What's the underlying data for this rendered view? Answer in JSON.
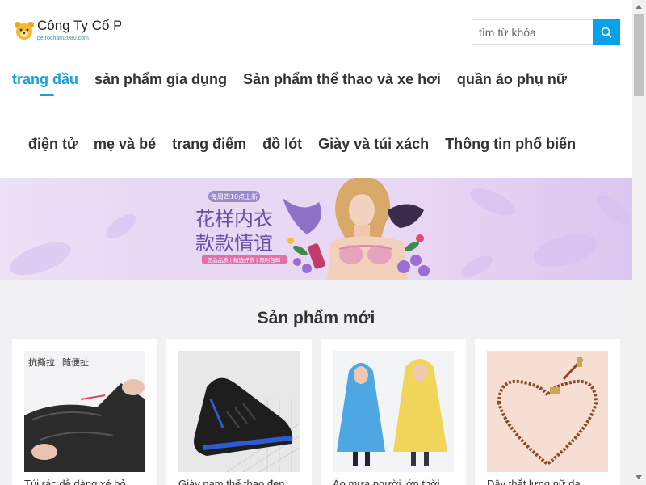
{
  "header": {
    "company_name": "Công Ty Cổ P",
    "company_sub": "petrocham2080.com",
    "search_placeholder": "tìm từ khóa"
  },
  "nav": {
    "row1": [
      "trang đầu",
      "sản phẩm gia dụng",
      "Sản phẩm thể thao và xe hơi",
      "quần áo phụ nữ"
    ],
    "row2": [
      "điện tử",
      "mẹ và bé",
      "trang điểm",
      "đồ lót",
      "Giày và túi xách",
      "Thông tin phổ biến"
    ]
  },
  "banner": {
    "tag": "每周四10点上新",
    "line1": "花样内衣",
    "line2": "款款情谊",
    "bar": "正品品质 | 精选好货 | 限时包邮"
  },
  "section": {
    "title": "Sản phẩm mới"
  },
  "products": [
    {
      "name": "Túi rác dễ dàng xé bỏ",
      "img_text1": "抗撕拉",
      "img_text2": "随便扯"
    },
    {
      "name": "Giày nam thể thao đen"
    },
    {
      "name": "Áo mưa người lớn thời"
    },
    {
      "name": "Dây thắt lưng nữ da"
    }
  ],
  "colors": {
    "accent": "#1a9fd6",
    "search_button": "#0aa0ea",
    "section_bg": "#f1f1f3"
  }
}
